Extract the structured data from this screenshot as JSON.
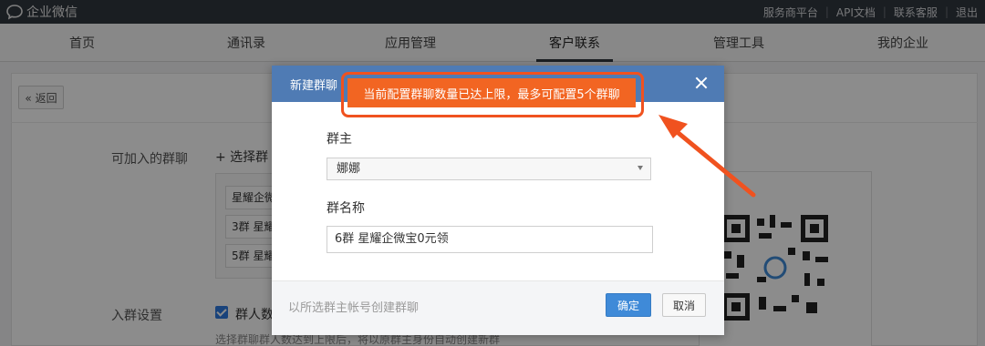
{
  "app": {
    "logo_text": "企业微信",
    "logo_icon": "wechat-work-icon"
  },
  "top_links": [
    "服务商平台",
    "API文档",
    "联系客服",
    "退出"
  ],
  "nav": {
    "items": [
      "首页",
      "通讯录",
      "应用管理",
      "客户联系",
      "管理工具",
      "我的企业"
    ],
    "active": "客户联系"
  },
  "page": {
    "back_label": "« 返回",
    "groups_label": "可加入的群聊",
    "select_group_label": "+ 选择群",
    "groups": [
      "星耀企微",
      "3群 星耀",
      "5群 星耀"
    ],
    "settings_label": "入群设置",
    "checkbox_label": "群人数",
    "hint": "选择群聊群人数达到上限后，将以原群主身份自动创建新群"
  },
  "modal": {
    "title": "新建群聊",
    "owner_label": "群主",
    "owner_value": "娜娜",
    "name_label": "群名称",
    "name_value": "6群 星耀企微宝0元领",
    "footer_note": "以所选群主帐号创建群聊",
    "ok_label": "确定",
    "cancel_label": "取消"
  },
  "alert": {
    "message": "当前配置群聊数量已达上限，最多可配置5个群聊",
    "color": "#f26522"
  },
  "colors": {
    "topbar": "#31373f",
    "modal_header": "#4f7bb4",
    "primary_button": "#3f8ad8",
    "annotation": "#f0521f"
  }
}
